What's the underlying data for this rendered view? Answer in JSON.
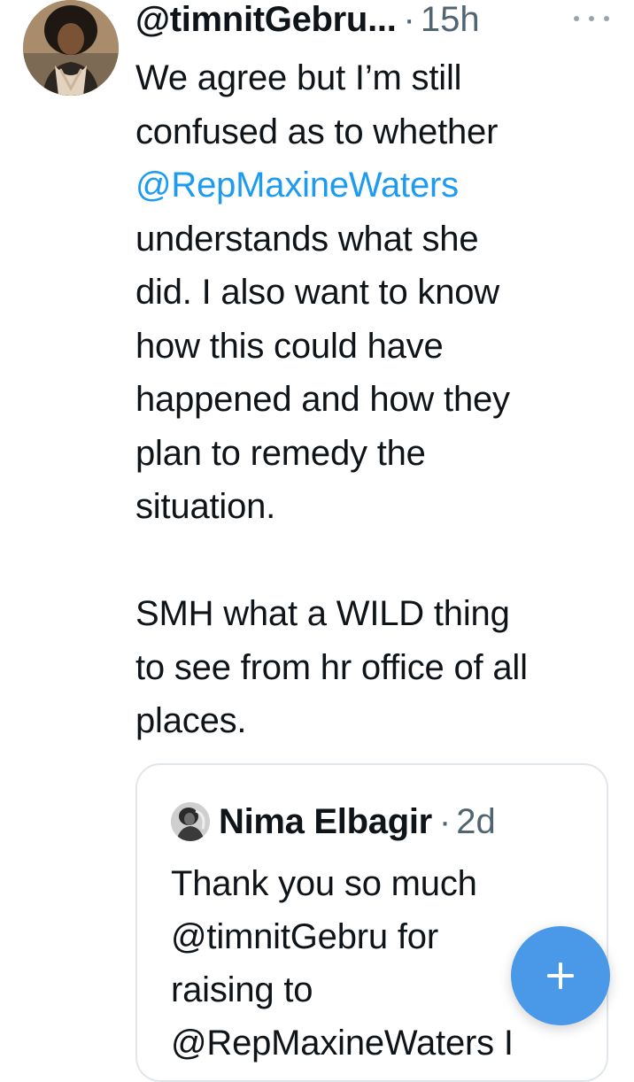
{
  "tweet": {
    "handle": "@timnitGebru...",
    "separator": "·",
    "time": "15h",
    "more_icon": "more-horizontal-icon",
    "body_lines": [
      {
        "text": "We agree but I’m still",
        "mention": false
      },
      {
        "text": "confused as to whether",
        "mention": false
      },
      {
        "text": "@RepMaxineWaters",
        "mention": true
      },
      {
        "text": "understands what she",
        "mention": false
      },
      {
        "text": "did. I also want to know",
        "mention": false
      },
      {
        "text": "how this could have",
        "mention": false
      },
      {
        "text": "happened and how they",
        "mention": false
      },
      {
        "text": "plan to remedy the",
        "mention": false
      },
      {
        "text": "situation.",
        "mention": false
      }
    ],
    "body_lines_2": [
      "SMH what a WILD thing",
      "to see from hr office of all",
      "places."
    ]
  },
  "quote": {
    "name": "Nima Elbagir",
    "separator": "·",
    "time": "2d",
    "body_lines": [
      {
        "text": "Thank you so much",
        "mention": false
      },
      {
        "text": "@timnitGebru for",
        "mention": false
      },
      {
        "text": "raising to",
        "mention": false
      },
      {
        "text": "@RepMaxineWaters I",
        "mention": false
      }
    ]
  },
  "fab": {
    "icon": "plus-icon",
    "color": "#4a99e9"
  },
  "colors": {
    "text": "#0f1419",
    "secondary": "#536471",
    "link": "#1d9bf0",
    "border": "#e1e6ea"
  }
}
